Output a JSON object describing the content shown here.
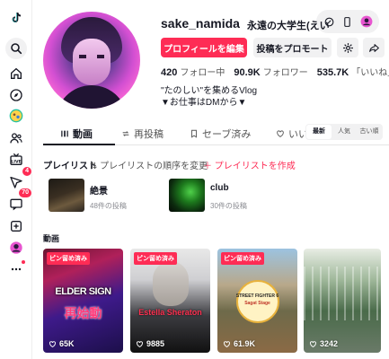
{
  "profile": {
    "username": "sake_namida",
    "nickname": "永遠の大学生(えいだい)",
    "edit_label": "プロフィールを編集",
    "promote_label": "投稿をプロモート",
    "stats": [
      {
        "value": "420",
        "label": "フォロー中"
      },
      {
        "value": "90.9K",
        "label": "フォロワー"
      },
      {
        "value": "535.7K",
        "label": "「いいね」"
      }
    ],
    "bio_line1": "\"たのしい\"を集めるVlog",
    "bio_line2": "▼お仕事はDMから▼"
  },
  "sidebar": {
    "activity_badge": "4",
    "messages_badge": "70"
  },
  "tabs": [
    {
      "label": "動画",
      "icon": "grid-icon"
    },
    {
      "label": "再投稿",
      "icon": "repost-icon"
    },
    {
      "label": "セーブ済み",
      "icon": "bookmark-icon"
    },
    {
      "label": "いいね",
      "icon": "heart-outline-icon"
    }
  ],
  "sort_options": [
    "最新",
    "人気",
    "古い順"
  ],
  "playlists": {
    "header": "プレイリスト",
    "reorder_label": "プレイリストの順序を変更",
    "create_label": "プレイリストを作成",
    "items": [
      {
        "name": "絶景",
        "count": "48件の投稿"
      },
      {
        "name": "club",
        "count": "30件の投稿"
      }
    ]
  },
  "videos": {
    "title": "動画",
    "items": [
      {
        "pinned": "ピン留め済み",
        "views": "65K",
        "caption_top": "ELDER SIGN",
        "caption_big": "再始動"
      },
      {
        "pinned": "ピン留め済み",
        "views": "9885",
        "caption_top": "Estella Sheraton"
      },
      {
        "pinned": "ピン留め済み",
        "views": "61.9K",
        "caption_top": "STREET FIGHTER 6",
        "caption_mid": "Sagat Stage"
      },
      {
        "views": "3242"
      }
    ]
  },
  "colors": {
    "accent": "#fe2c55",
    "text": "#161823"
  }
}
